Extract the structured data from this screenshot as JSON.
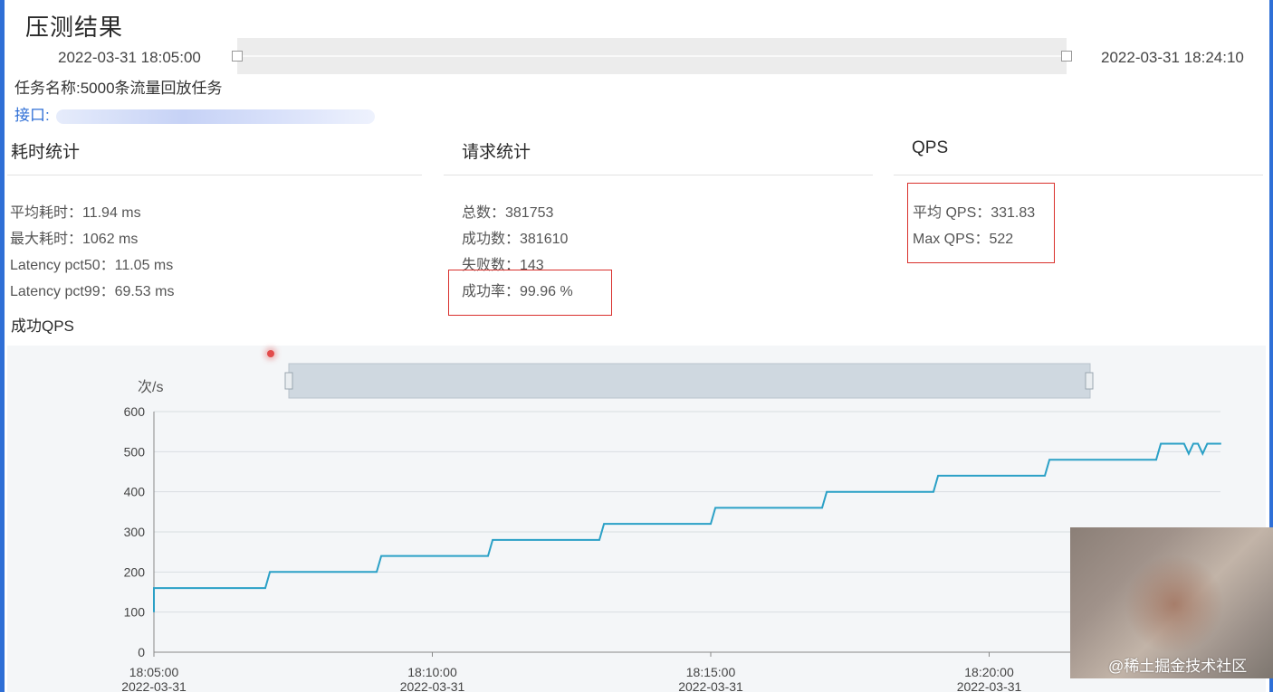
{
  "page": {
    "title": "压测结果",
    "time_range": {
      "start": "2022-03-31 18:05:00",
      "end": "2022-03-31 18:24:10"
    },
    "task_name": "任务名称:5000条流量回放任务",
    "api_label": "接口:"
  },
  "sections": {
    "latency": {
      "title": "耗时统计",
      "items": [
        "平均耗时：11.94 ms",
        "最大耗时：1062 ms",
        "Latency pct50：11.05 ms",
        "Latency pct99：69.53 ms"
      ]
    },
    "requests": {
      "title": "请求统计",
      "items": [
        "总数：381753",
        "成功数：381610",
        "失败数：143",
        "成功率：99.96 %"
      ]
    },
    "qps": {
      "title": "QPS",
      "items": [
        "平均 QPS：331.83",
        "Max QPS：522"
      ]
    }
  },
  "chart_section_title": "成功QPS",
  "chart_data": {
    "type": "line",
    "ylabel": "次/s",
    "ylim": [
      0,
      600
    ],
    "yticks": [
      "0",
      "100",
      "200",
      "300",
      "400",
      "500",
      "600"
    ],
    "xticks": [
      {
        "time": "18:05:00",
        "date": "2022-03-31"
      },
      {
        "time": "18:10:00",
        "date": "2022-03-31"
      },
      {
        "time": "18:15:00",
        "date": "2022-03-31"
      },
      {
        "time": "18:20:00",
        "date": "2022-03-31"
      }
    ],
    "grid": true,
    "series": [
      {
        "color": "#2aa0c6",
        "x": [
          "18:05:00",
          "18:05:00",
          "18:07:00",
          "18:07:05",
          "18:09:00",
          "18:09:05",
          "18:11:00",
          "18:11:05",
          "18:13:00",
          "18:13:05",
          "18:15:00",
          "18:15:05",
          "18:17:00",
          "18:17:05",
          "18:19:00",
          "18:19:05",
          "18:21:00",
          "18:21:05",
          "18:23:00",
          "18:23:05",
          "18:23:30",
          "18:23:35",
          "18:23:40",
          "18:23:45",
          "18:23:50",
          "18:23:55",
          "18:24:10"
        ],
        "values": [
          100,
          160,
          160,
          200,
          200,
          240,
          240,
          280,
          280,
          320,
          320,
          360,
          360,
          400,
          400,
          440,
          440,
          480,
          480,
          520,
          520,
          495,
          520,
          520,
          495,
          520,
          520
        ]
      }
    ]
  },
  "watermark": "@稀土掘金技术社区",
  "colors": {
    "accent": "#2f6fd6",
    "line": "#2aa0c6",
    "highlight": "#d9302c"
  }
}
